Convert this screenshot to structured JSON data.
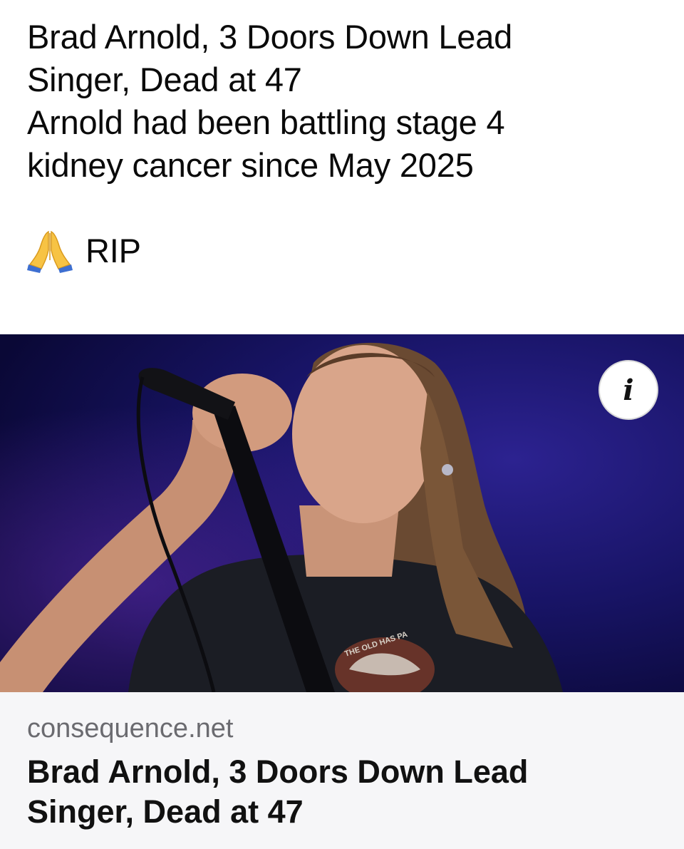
{
  "post": {
    "text_lines": [
      "Brad Arnold, 3 Doors Down Lead",
      "Singer, Dead at 47",
      "Arnold had been battling stage 4",
      "kidney cancer since May 2025"
    ],
    "rip_emoji": "folded-hands-icon",
    "rip_text": "RIP"
  },
  "link_card": {
    "image_alt": "Brad Arnold singing into a microphone on stage",
    "info_icon": "i",
    "domain": "consequence.net",
    "title_lines": [
      "Brad Arnold, 3 Doors Down Lead",
      "Singer, Dead at 47"
    ],
    "shirt_text": "THE OLD HAS PA"
  },
  "colors": {
    "background": "#ffffff",
    "card_background": "#f6f6f8",
    "domain_text": "#6b6b70",
    "stage_blue": "#1a1560",
    "emoji_yellow": "#f7c344",
    "emoji_cuff": "#3d6fd1"
  }
}
